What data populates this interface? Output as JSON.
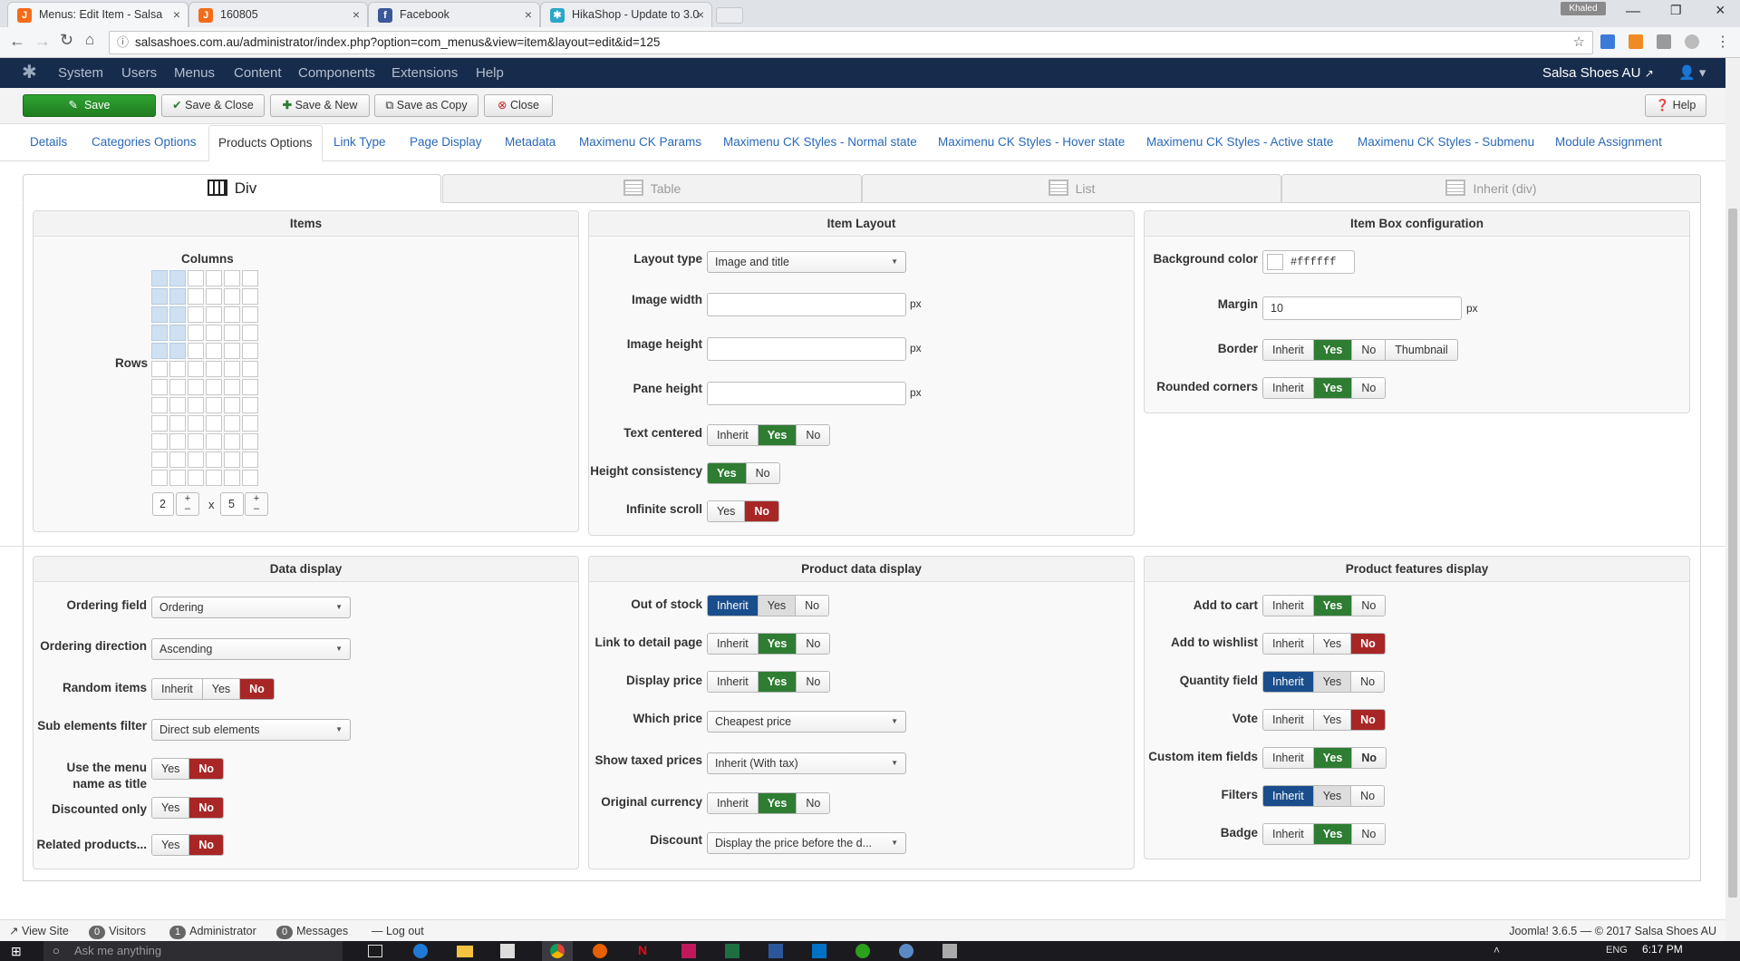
{
  "browser": {
    "tabs": [
      {
        "title": "Menus: Edit Item - Salsa",
        "fav": "J",
        "color": "#f46c1a"
      },
      {
        "title": "160805",
        "fav": "J",
        "color": "#f46c1a"
      },
      {
        "title": "Facebook",
        "fav": "f",
        "color": "#3b5998"
      },
      {
        "title": "HikaShop - Update to 3.0",
        "fav": "✱",
        "color": "#2aa7c9"
      }
    ],
    "profile": "Khaled",
    "url": "salsashoes.com.au/administrator/index.php?option=com_menus&view=item&layout=edit&id=125"
  },
  "nav": {
    "items": [
      "System",
      "Users",
      "Menus",
      "Content",
      "Components",
      "Extensions",
      "Help"
    ],
    "site": "Salsa Shoes AU"
  },
  "toolbar": {
    "save": "Save",
    "save_close": "Save & Close",
    "save_new": "Save & New",
    "save_copy": "Save as Copy",
    "close": "Close",
    "help": "Help"
  },
  "tabs": [
    "Details",
    "Categories Options",
    "Products Options",
    "Link Type",
    "Page Display",
    "Metadata",
    "Maximenu CK Params",
    "Maximenu CK Styles - Normal state",
    "Maximenu CK Styles - Hover state",
    "Maximenu CK Styles - Active state",
    "Maximenu CK Styles - Submenu",
    "Module Assignment"
  ],
  "layout_tabs": [
    "Div",
    "Table",
    "List",
    "Inherit (div)"
  ],
  "items": {
    "title": "Items",
    "columns_label": "Columns",
    "rows_label": "Rows",
    "columns": "2",
    "rows": "5",
    "x": "x"
  },
  "item_layout": {
    "title": "Item Layout",
    "layout_type_label": "Layout type",
    "layout_type": "Image and title",
    "image_width_label": "Image width",
    "image_height_label": "Image height",
    "pane_height_label": "Pane height",
    "px": "px",
    "text_centered_label": "Text centered",
    "height_consistency_label": "Height consistency",
    "infinite_scroll_label": "Infinite scroll"
  },
  "item_box": {
    "title": "Item Box configuration",
    "bg_label": "Background color",
    "bg_value": "#ffffff",
    "margin_label": "Margin",
    "margin_value": "10",
    "border_label": "Border",
    "rounded_label": "Rounded corners"
  },
  "data_display": {
    "title": "Data display",
    "ordering_field_label": "Ordering field",
    "ordering_field": "Ordering",
    "ordering_dir_label": "Ordering direction",
    "ordering_dir": "Ascending",
    "random_label": "Random items",
    "sub_filter_label": "Sub elements filter",
    "sub_filter": "Direct sub elements",
    "menu_name_label_1": "Use the menu",
    "menu_name_label_2": "name as title",
    "discounted_label": "Discounted only",
    "related_label": "Related products..."
  },
  "product_data": {
    "title": "Product data display",
    "out_of_stock_label": "Out of stock",
    "link_detail_label": "Link to detail page",
    "display_price_label": "Display price",
    "which_price_label": "Which price",
    "which_price": "Cheapest price",
    "taxed_label": "Show taxed prices",
    "taxed": "Inherit (With tax)",
    "orig_currency_label": "Original currency",
    "discount_label": "Discount",
    "discount": "Display the price before the d..."
  },
  "features": {
    "title": "Product features display",
    "add_to_cart_label": "Add to cart",
    "wishlist_label": "Add to wishlist",
    "quantity_label": "Quantity field",
    "vote_label": "Vote",
    "custom_fields_label": "Custom item fields",
    "filters_label": "Filters",
    "badge_label": "Badge"
  },
  "opts": {
    "inherit": "Inherit",
    "yes": "Yes",
    "no": "No",
    "thumbnail": "Thumbnail"
  },
  "status": {
    "view_site": "View Site",
    "visitors_count": "0",
    "visitors": "Visitors",
    "admin_count": "1",
    "admin": "Administrator",
    "messages_count": "0",
    "messages": "Messages",
    "logout": "Log out",
    "version": "Joomla! 3.6.5 — © 2017 Salsa Shoes AU"
  },
  "taskbar": {
    "search": "Ask me anything",
    "lang": "ENG",
    "time": "6:17 PM"
  }
}
